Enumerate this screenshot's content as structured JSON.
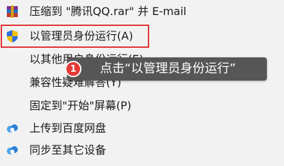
{
  "menu": {
    "items": [
      {
        "label": "压缩到 \"腾讯QQ.rar\" 并 E-mail",
        "icon": "winrar-icon"
      },
      {
        "label": "以管理员身份运行(A)",
        "icon": "uac-shield-icon"
      },
      {
        "label": "以其他用户身份运行(E)",
        "icon": ""
      },
      {
        "label": "兼容性疑难解答(Y)",
        "icon": ""
      },
      {
        "label": "固定到\"开始\"屏幕(P)",
        "icon": ""
      },
      {
        "label": "上传到百度网盘",
        "icon": "baidu-netdisk-icon"
      },
      {
        "label": "同步至其它设备",
        "icon": "baidu-netdisk-icon"
      }
    ]
  },
  "callout": {
    "number": "1",
    "text": "点击“以管理员身份运行”"
  },
  "colors": {
    "menu_background": "#f2f2f2",
    "highlight_border": "#e03333",
    "tooltip_background": "#565656",
    "badge": "#e53935"
  }
}
